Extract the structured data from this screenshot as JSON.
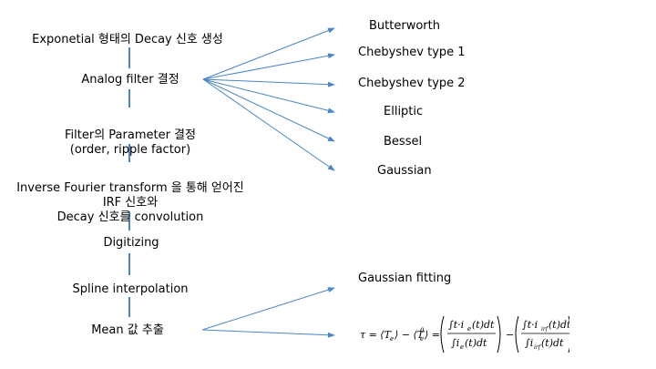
{
  "steps": [
    {
      "label": "Exponetial 형태의 Decay 신호 생성"
    },
    {
      "label": "Analog filter 결정"
    },
    {
      "label": "Filter의 Parameter 결정\n(order, ripple factor)"
    },
    {
      "label": "Inverse Fourier transform 을 통해 얻어진\nIRF 신호와\nDecay 신호를 convolution"
    },
    {
      "label": "Digitizing"
    },
    {
      "label": "Spline interpolation"
    },
    {
      "label": "Mean 값 추출"
    }
  ],
  "filter_options": [
    "Butterworth",
    "Chebyshev type 1",
    "Chebyshev type 2",
    "Elliptic",
    "Bessel",
    "Gaussian"
  ],
  "mean_options": [
    "Gaussian fitting"
  ],
  "formula_text": "τ = ⟨Te⟩ − ⟨Te0⟩ = (∫t·ie(t)dt / ∫ie(t)dt) − (∫t·iirf(t)dt / ∫iirf(t)dt)",
  "colors": {
    "arrow": "#4a86c8",
    "text": "#000000"
  }
}
